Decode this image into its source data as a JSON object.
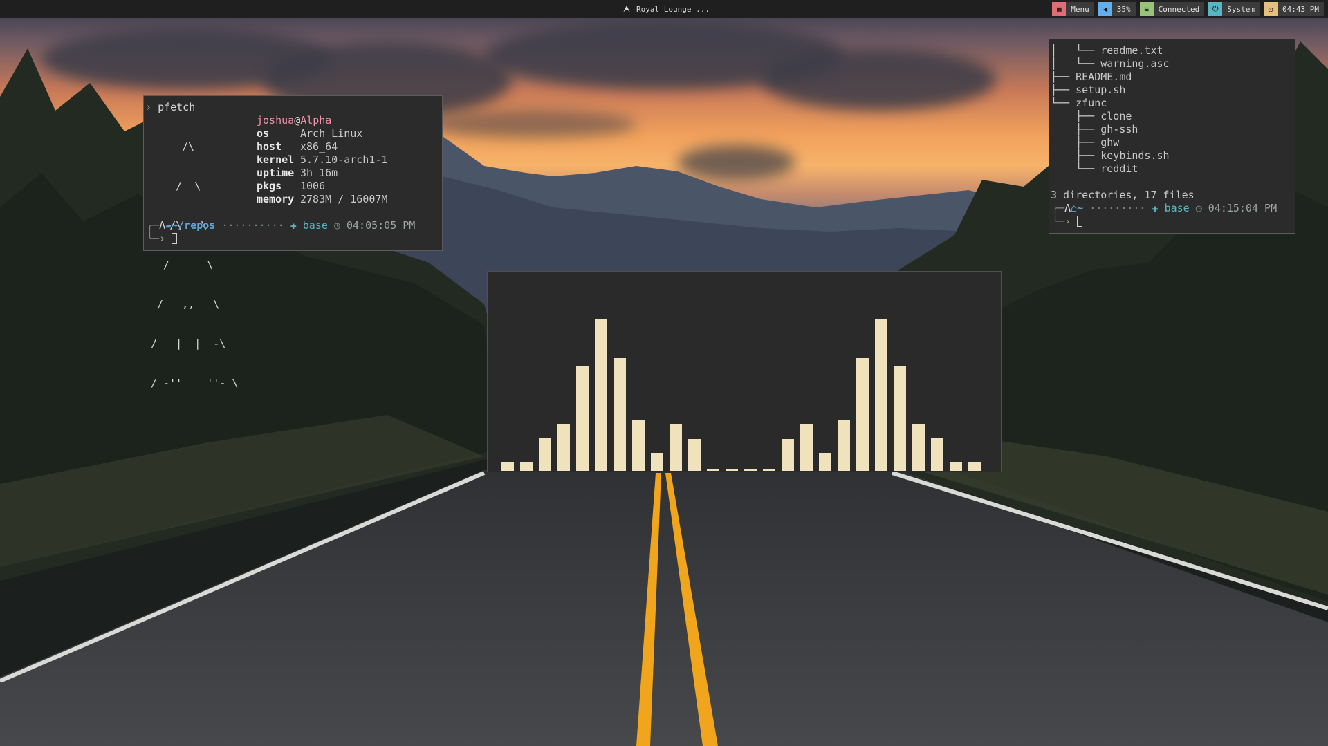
{
  "topbar": {
    "window_title": "Royal Lounge ...",
    "modules": [
      {
        "name": "menu",
        "label": "Menu",
        "icon": "grid-icon",
        "color": "#e06c75"
      },
      {
        "name": "volume",
        "label": "35%",
        "icon": "speaker-icon",
        "color": "#61afef"
      },
      {
        "name": "network",
        "label": "Connected",
        "icon": "wifi-icon",
        "color": "#98c379"
      },
      {
        "name": "system",
        "label": "System",
        "icon": "power-icon",
        "color": "#56b6c2"
      },
      {
        "name": "clock",
        "label": "04:43 PM",
        "icon": "clock-icon",
        "color": "#e5c07b"
      }
    ]
  },
  "pfetch": {
    "command": "pfetch",
    "user": "joshua",
    "at": "@",
    "hostname": "Alpha",
    "fields": [
      {
        "key": "os",
        "value": "Arch Linux"
      },
      {
        "key": "host",
        "value": "x86_64"
      },
      {
        "key": "kernel",
        "value": "5.7.10-arch1-1"
      },
      {
        "key": "uptime",
        "value": "3h 16m"
      },
      {
        "key": "pkgs",
        "value": "1006"
      },
      {
        "key": "memory",
        "value": "2783M / 16007M"
      }
    ],
    "logo_lines": [
      "     /\\",
      "    /  \\",
      "   /\\   \\",
      "  /      \\",
      " /   ,,   \\",
      "/   |  |  -\\",
      "/_-''    ''-_\\"
    ],
    "prompt": {
      "path": "~/repos",
      "dots": "··········",
      "env": "base",
      "time": "04:05:05 PM"
    }
  },
  "tree_terminal": {
    "lines": [
      {
        "prefix": "│   └── ",
        "name": "readme.txt"
      },
      {
        "prefix": "│   └── ",
        "name": "warning.asc"
      },
      {
        "prefix": "├── ",
        "name": "README.md"
      },
      {
        "prefix": "├── ",
        "name": "setup.sh"
      },
      {
        "prefix": "└── ",
        "name": "zfunc"
      },
      {
        "prefix": "    ├── ",
        "name": "clone"
      },
      {
        "prefix": "    ├── ",
        "name": "gh-ssh"
      },
      {
        "prefix": "    ├── ",
        "name": "ghw"
      },
      {
        "prefix": "    ├── ",
        "name": "keybinds.sh"
      },
      {
        "prefix": "    └── ",
        "name": "reddit"
      }
    ],
    "summary": "3 directories, 17 files",
    "prompt": {
      "path": "~",
      "dots": "·········",
      "env": "base",
      "time": "04:15:04 PM"
    }
  },
  "visualizer": {
    "bar_color": "#efe2bd",
    "levels": [
      0.06,
      0.06,
      0.22,
      0.31,
      0.69,
      1.0,
      0.74,
      0.33,
      0.12,
      0.31,
      0.21,
      0.01,
      0.01,
      0.01,
      0.01,
      0.21,
      0.31,
      0.12,
      0.33,
      0.74,
      1.0,
      0.69,
      0.31,
      0.22,
      0.06,
      0.06
    ]
  }
}
